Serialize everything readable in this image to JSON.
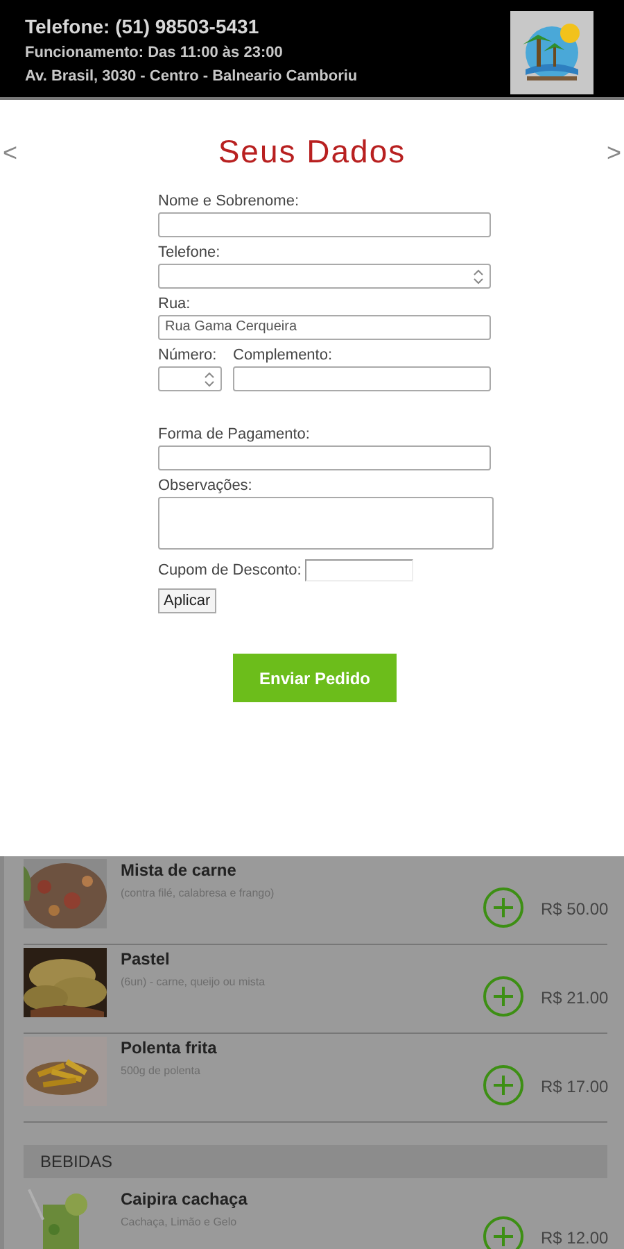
{
  "header": {
    "phone": "Telefone: (51) 98503-5431",
    "hours": "Funcionamento: Das 11:00 às 23:00",
    "address": "Av. Brasil, 3030 - Centro - Balneario Camboriu"
  },
  "form": {
    "title": "Seus Dados",
    "prev": "<",
    "next": ">",
    "fields": [
      {
        "kind": "text",
        "label": "Nome e Sobrenome:"
      },
      {
        "kind": "number",
        "label": "Telefone:"
      },
      {
        "kind": "text",
        "label": "Rua:",
        "value": "Rua Gama Cerqueira"
      },
      {
        "kind": "pair",
        "items": [
          {
            "kind": "number",
            "label": "Número:"
          },
          {
            "kind": "text",
            "label": "Complemento:"
          }
        ]
      },
      {
        "kind": "text",
        "label": "Forma de Pagamento:"
      },
      {
        "kind": "textarea",
        "label": "Observações:"
      }
    ],
    "coupon": {
      "label": "Cupom de Desconto:",
      "button": "Aplicar"
    },
    "submit": "Enviar Pedido"
  },
  "menu": [
    {
      "kind": "item",
      "name": "Mista de carne",
      "description": "(contra filé, calabresa e frango)",
      "price": "R$ 50.00"
    },
    {
      "kind": "item",
      "name": "Pastel",
      "description": "(6un) - carne, queijo ou mista",
      "price": "R$ 21.00"
    },
    {
      "kind": "item",
      "name": "Polenta frita",
      "description": "500g de polenta",
      "price": "R$ 17.00"
    },
    {
      "kind": "category",
      "name": "BEBIDAS"
    },
    {
      "kind": "item",
      "name": "Caipira cachaça",
      "description": "Cachaça, Limão e Gelo",
      "price": "R$ 12.00"
    }
  ]
}
